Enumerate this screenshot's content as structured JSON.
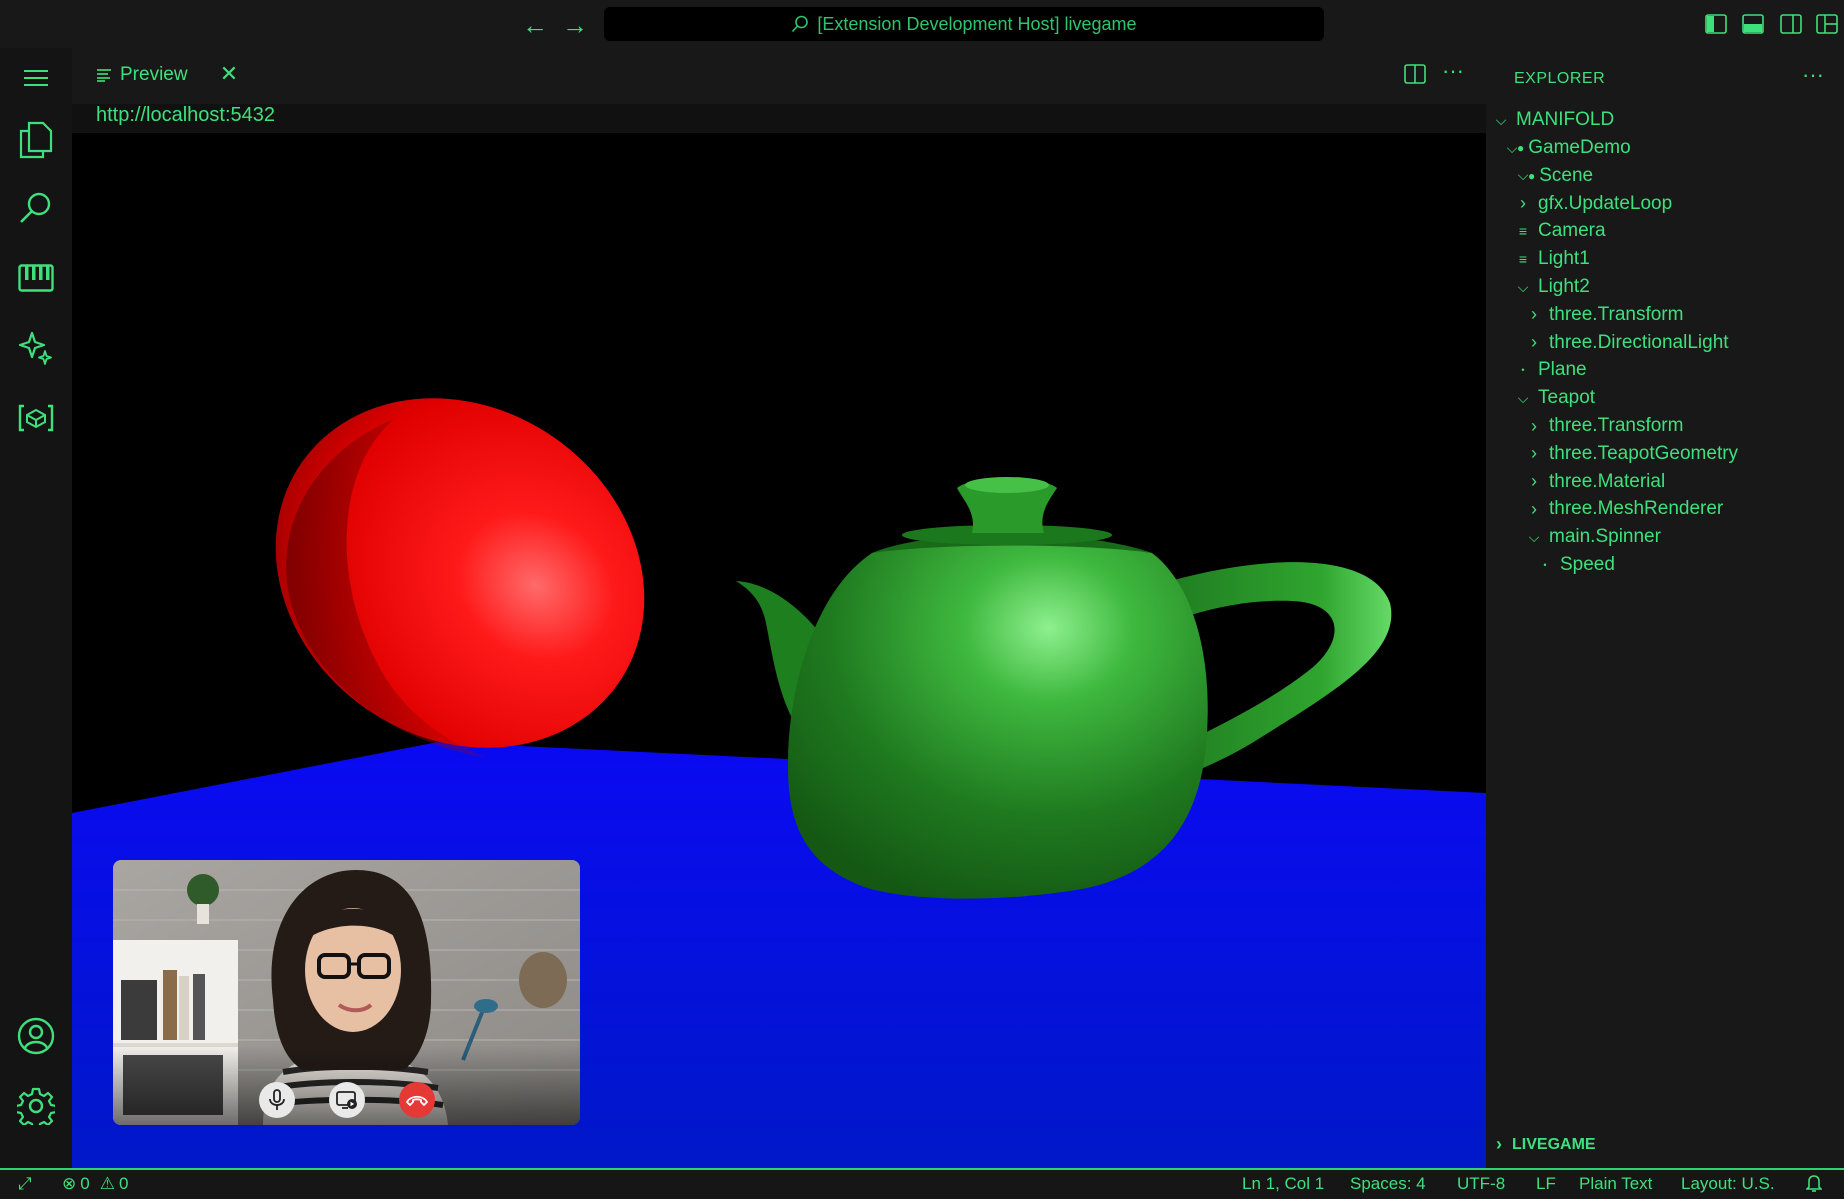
{
  "titlebar": {
    "back_icon": "arrow-left-icon",
    "forward_icon": "arrow-right-icon",
    "search_text": "[Extension Development Host] livegame"
  },
  "editor": {
    "tab_label": "Preview",
    "url": "http://localhost:5432"
  },
  "explorer": {
    "title": "EXPLORER",
    "more": "···",
    "root": "MANIFOLD",
    "items": [
      {
        "label": "GameDemo",
        "depth": 1,
        "marker": "chevron-down",
        "dot": true
      },
      {
        "label": "Scene",
        "depth": 2,
        "marker": "chevron-down",
        "dot": true
      },
      {
        "label": "gfx.UpdateLoop",
        "depth": 2,
        "marker": "chevron-right"
      },
      {
        "label": "Camera",
        "depth": 2,
        "marker": "lines"
      },
      {
        "label": "Light1",
        "depth": 2,
        "marker": "lines"
      },
      {
        "label": "Light2",
        "depth": 2,
        "marker": "chevron-down"
      },
      {
        "label": "three.Transform",
        "depth": 3,
        "marker": "chevron-right"
      },
      {
        "label": "three.DirectionalLight",
        "depth": 3,
        "marker": "chevron-right"
      },
      {
        "label": "Plane",
        "depth": 2,
        "marker": "small-dot"
      },
      {
        "label": "Teapot",
        "depth": 2,
        "marker": "chevron-down"
      },
      {
        "label": "three.Transform",
        "depth": 3,
        "marker": "chevron-right"
      },
      {
        "label": "three.TeapotGeometry",
        "depth": 3,
        "marker": "chevron-right"
      },
      {
        "label": "three.Material",
        "depth": 3,
        "marker": "chevron-right"
      },
      {
        "label": "three.MeshRenderer",
        "depth": 3,
        "marker": "chevron-right"
      },
      {
        "label": "main.Spinner",
        "depth": 3,
        "marker": "chevron-down"
      },
      {
        "label": "Speed",
        "depth": 4,
        "marker": "small-dot"
      }
    ],
    "section_livegame": "LIVEGAME"
  },
  "status": {
    "errors": "0",
    "warnings": "0",
    "position": "Ln 1, Col 1",
    "spaces": "Spaces: 4",
    "encoding": "UTF-8",
    "eol": "LF",
    "language": "Plain Text",
    "layout": "Layout: U.S."
  },
  "colors": {
    "accent": "#3ee07c",
    "sphere": "#ff2020",
    "teapot": "#2e9a2e",
    "plane": "#0a0aee",
    "hangup": "#e53935"
  }
}
